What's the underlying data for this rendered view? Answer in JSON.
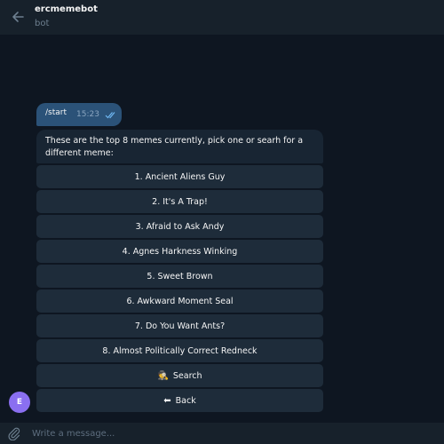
{
  "header": {
    "title": "ercmemebot",
    "subtitle": "bot"
  },
  "messages": {
    "outgoing": {
      "text": "/start",
      "time": "15:23"
    },
    "incoming": {
      "text": "These are the top 8 memes currently, pick one or searh for a different meme:"
    }
  },
  "keyboard": {
    "buttons": [
      {
        "label": "1. Ancient Aliens Guy"
      },
      {
        "label": "2. It's A Trap!"
      },
      {
        "label": "3. Afraid to Ask Andy"
      },
      {
        "label": "4. Agnes Harkness Winking"
      },
      {
        "label": "5. Sweet Brown"
      },
      {
        "label": "6. Awkward Moment Seal"
      },
      {
        "label": "7. Do You Want Ants?"
      },
      {
        "label": "8. Almost Politically Correct Redneck"
      },
      {
        "label": "Search",
        "emoji": "🕵"
      },
      {
        "label": "Back",
        "emoji": "⬅"
      }
    ]
  },
  "avatar": {
    "initial": "E",
    "color": "#8a6ff0"
  },
  "composer": {
    "placeholder": "Write a message..."
  },
  "icons": {
    "back": "back-arrow-icon",
    "read_receipt": "double-check-icon",
    "attach": "paperclip-icon"
  },
  "colors": {
    "background": "#0e1621",
    "header": "#17212b",
    "outgoing_bubble": "#2b5278",
    "incoming_bubble": "#182533",
    "keyboard_button": "#1e2c3a"
  }
}
